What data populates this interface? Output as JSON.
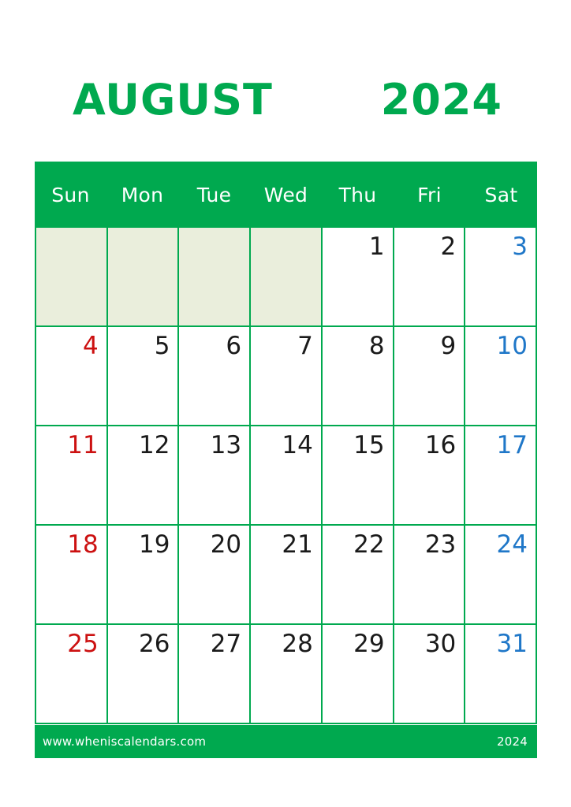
{
  "title": {
    "month": "AUGUST",
    "year": "2024"
  },
  "colors": {
    "brand_green": "#00a94f",
    "blank_cell": "#eaeedc",
    "sunday_red": "#cc1111",
    "saturday_blue": "#1f77c8",
    "weekday_black": "#1a1a1a",
    "header_text": "#ffffff"
  },
  "weekdays": [
    {
      "label": "Sun"
    },
    {
      "label": "Mon"
    },
    {
      "label": "Tue"
    },
    {
      "label": "Wed"
    },
    {
      "label": "Thu"
    },
    {
      "label": "Fri"
    },
    {
      "label": "Sat"
    }
  ],
  "weeks": [
    [
      {
        "day": "",
        "kind": "blank"
      },
      {
        "day": "",
        "kind": "blank"
      },
      {
        "day": "",
        "kind": "blank"
      },
      {
        "day": "",
        "kind": "blank"
      },
      {
        "day": "1",
        "kind": "weekday"
      },
      {
        "day": "2",
        "kind": "weekday"
      },
      {
        "day": "3",
        "kind": "sat"
      }
    ],
    [
      {
        "day": "4",
        "kind": "sun"
      },
      {
        "day": "5",
        "kind": "weekday"
      },
      {
        "day": "6",
        "kind": "weekday"
      },
      {
        "day": "7",
        "kind": "weekday"
      },
      {
        "day": "8",
        "kind": "weekday"
      },
      {
        "day": "9",
        "kind": "weekday"
      },
      {
        "day": "10",
        "kind": "sat"
      }
    ],
    [
      {
        "day": "11",
        "kind": "sun"
      },
      {
        "day": "12",
        "kind": "weekday"
      },
      {
        "day": "13",
        "kind": "weekday"
      },
      {
        "day": "14",
        "kind": "weekday"
      },
      {
        "day": "15",
        "kind": "weekday"
      },
      {
        "day": "16",
        "kind": "weekday"
      },
      {
        "day": "17",
        "kind": "sat"
      }
    ],
    [
      {
        "day": "18",
        "kind": "sun"
      },
      {
        "day": "19",
        "kind": "weekday"
      },
      {
        "day": "20",
        "kind": "weekday"
      },
      {
        "day": "21",
        "kind": "weekday"
      },
      {
        "day": "22",
        "kind": "weekday"
      },
      {
        "day": "23",
        "kind": "weekday"
      },
      {
        "day": "24",
        "kind": "sat"
      }
    ],
    [
      {
        "day": "25",
        "kind": "sun"
      },
      {
        "day": "26",
        "kind": "weekday"
      },
      {
        "day": "27",
        "kind": "weekday"
      },
      {
        "day": "28",
        "kind": "weekday"
      },
      {
        "day": "29",
        "kind": "weekday"
      },
      {
        "day": "30",
        "kind": "weekday"
      },
      {
        "day": "31",
        "kind": "sat"
      }
    ]
  ],
  "footer": {
    "website": "www.wheniscalendars.com",
    "year": "2024"
  }
}
